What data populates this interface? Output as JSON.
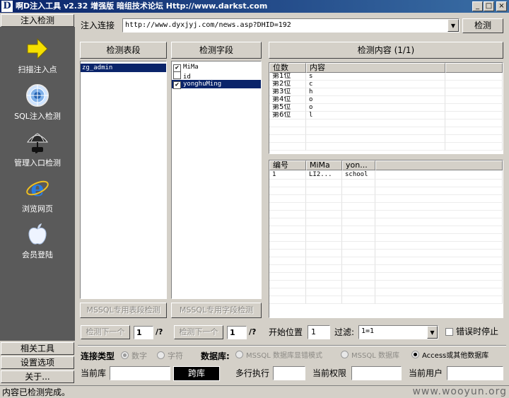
{
  "window": {
    "title": "啊D注入工具 v2.32 增强版 暗组技术论坛 Http://www.darkst.com",
    "minimize": "_",
    "maximize": "□",
    "close": "×"
  },
  "sidebar": {
    "header": "注入检测",
    "items": [
      {
        "label": "扫描注入点",
        "icon": "arrow-right-icon"
      },
      {
        "label": "SQL注入检测",
        "icon": "globe-target-icon"
      },
      {
        "label": "管理入口检测",
        "icon": "umbrella-icon"
      },
      {
        "label": "浏览网页",
        "icon": "internet-explorer-icon"
      },
      {
        "label": "会员登陆",
        "icon": "apple-icon"
      }
    ],
    "footer_buttons": [
      "相关工具",
      "设置选项",
      "关于..."
    ]
  },
  "url_bar": {
    "label": "注入连接",
    "value": "http://www.dyxjyj.com/news.asp?DHID=192",
    "button": "检测"
  },
  "tables_panel": {
    "header": "检测表段",
    "items": [
      "zg_admin"
    ],
    "button": "MSSQL专用表段检测"
  },
  "fields_panel": {
    "header": "检测字段",
    "items": [
      {
        "name": "MiMa",
        "checked": "✔"
      },
      {
        "name": "id",
        "checked": ""
      },
      {
        "name": "yonghuMing",
        "checked": "✔"
      }
    ],
    "button": "MSSQL专用字段检测"
  },
  "content_panel": {
    "header": "检测内容 (1/1)",
    "position_grid": {
      "columns": [
        "位数",
        "内容"
      ],
      "rows": [
        [
          "第1位",
          "s"
        ],
        [
          "第2位",
          "c"
        ],
        [
          "第3位",
          "h"
        ],
        [
          "第4位",
          "o"
        ],
        [
          "第5位",
          "o"
        ],
        [
          "第6位",
          "l"
        ]
      ]
    },
    "result_grid": {
      "columns": [
        "编号",
        "MiMa",
        "yon..."
      ],
      "rows": [
        [
          "1",
          "LI2...",
          "school"
        ]
      ]
    }
  },
  "paging": {
    "next_button_1": "检测下一个",
    "page_1": "1",
    "total_1": "/?",
    "next_button_2": "检测下一个",
    "page_2": "1",
    "total_2": "/?",
    "start_label": "开始位置",
    "start_value": "1",
    "filter_label": "过滤:",
    "filter_value": "1=1",
    "stop_on_error": "错误时停止"
  },
  "connection": {
    "type_label": "连接类型",
    "type_options": [
      "数字",
      "字符"
    ],
    "db_label": "数据库:",
    "db_options": [
      "MSSQL 数据库显错模式",
      "MSSQL 数据库",
      "Access或其他数据库"
    ]
  },
  "info_row": {
    "current_db_label": "当前库",
    "current_db_value": "",
    "cross_db_button": "跨库",
    "multi_exec_label": "多行执行",
    "multi_exec_value": "",
    "current_perm_label": "当前权限",
    "current_perm_value": "",
    "current_user_label": "当前用户",
    "current_user_value": ""
  },
  "status_bar": {
    "text": "内容已检测完成。"
  },
  "watermark": "www.wooyun.org"
}
